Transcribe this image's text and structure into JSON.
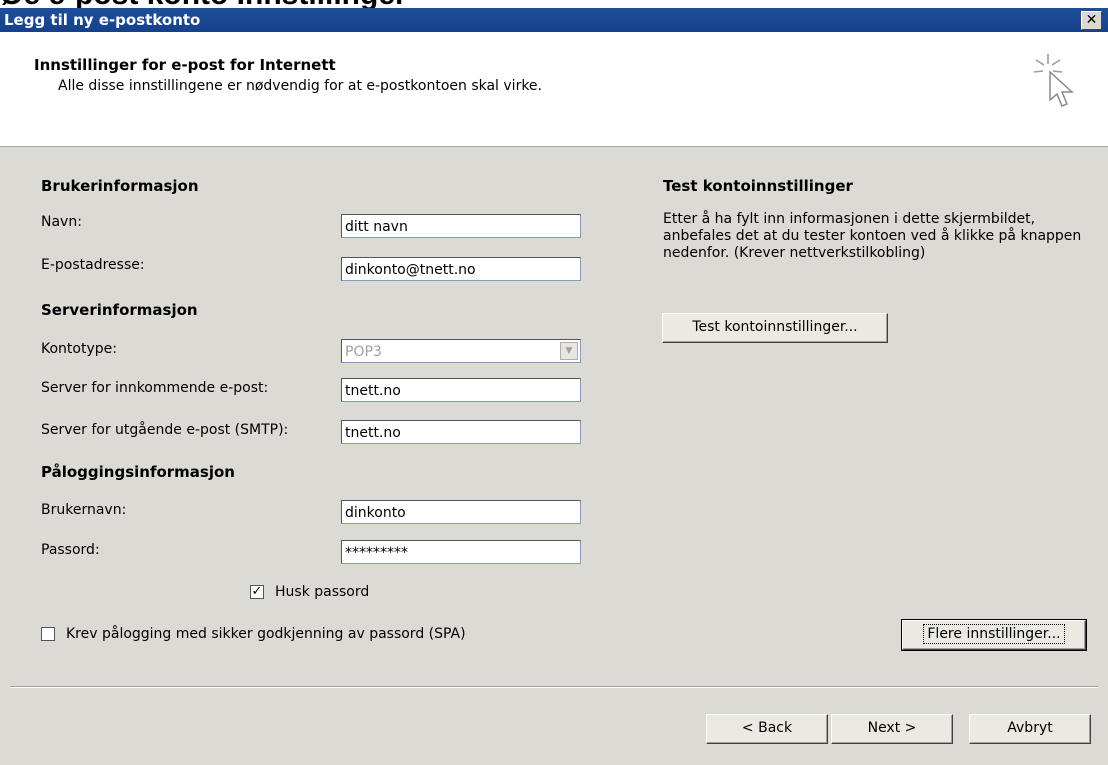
{
  "caption_fragment": "Øe e-post konto Innstillinger",
  "window": {
    "title": "Legg til ny e-postkonto",
    "close_glyph": "✕"
  },
  "header": {
    "title": "Innstillinger for e-post for Internett",
    "subtitle": "Alle disse innstillingene er nødvendig for at e-postkontoen skal virke."
  },
  "user_info": {
    "heading": "Brukerinformasjon",
    "name_label": "Navn:",
    "name_value": "ditt navn",
    "email_label": "E-postadresse:",
    "email_value": "dinkonto@tnett.no"
  },
  "server_info": {
    "heading": "Serverinformasjon",
    "account_type_label": "Kontotype:",
    "account_type_value": "POP3",
    "incoming_label": "Server for innkommende e-post:",
    "incoming_value": "tnett.no",
    "outgoing_label": "Server for utgående e-post (SMTP):",
    "outgoing_value": "tnett.no"
  },
  "login_info": {
    "heading": "Påloggingsinformasjon",
    "username_label": "Brukernavn:",
    "username_value": "dinkonto",
    "password_label": "Passord:",
    "password_value": "*********",
    "remember_label": "Husk passord",
    "remember_checked": true,
    "spa_label": "Krev pålogging med sikker godkjenning av passord (SPA)",
    "spa_checked": false
  },
  "test": {
    "heading": "Test kontoinnstillinger",
    "description": "Etter å ha fylt inn informasjonen i dette skjermbildet, anbefales det at du tester kontoen ved å klikke på knappen nedenfor. (Krever nettverkstilkobling)",
    "button_label": "Test kontoinnstillinger..."
  },
  "more_settings_label": "Flere innstillinger...",
  "footer": {
    "back_label": "< Back",
    "next_label": "Next >",
    "cancel_label": "Avbryt"
  }
}
